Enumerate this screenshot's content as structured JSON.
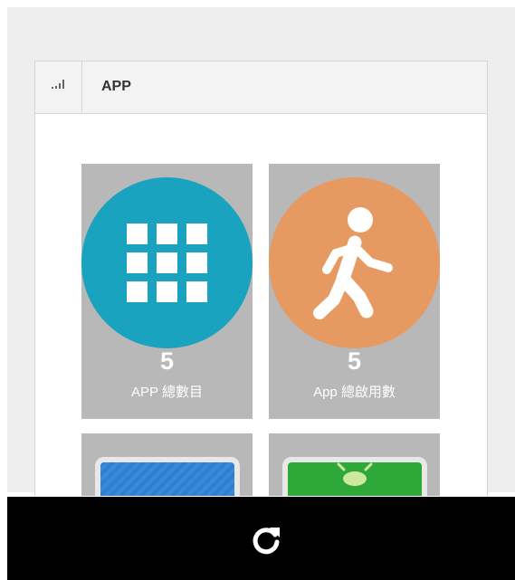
{
  "panel": {
    "title": "APP",
    "icon": "signal-bars-icon"
  },
  "tiles": [
    {
      "count": "5",
      "label": "APP 總數目",
      "icon": "grid-icon",
      "color": "#1aa3bf"
    },
    {
      "count": "5",
      "label": "App 總啟用數",
      "icon": "walking-person-icon",
      "color": "#e69a62"
    }
  ],
  "partial_tiles": [
    {
      "icon": "blue-app-icon",
      "color": "#2f7fd0"
    },
    {
      "icon": "green-app-icon",
      "color": "#2fa83a"
    }
  ],
  "toolbar": {
    "refresh_icon": "refresh-icon"
  },
  "colors": {
    "background": "#eeeeee",
    "tile_bg": "#b8b8b8",
    "bottom_bar": "#000000"
  }
}
